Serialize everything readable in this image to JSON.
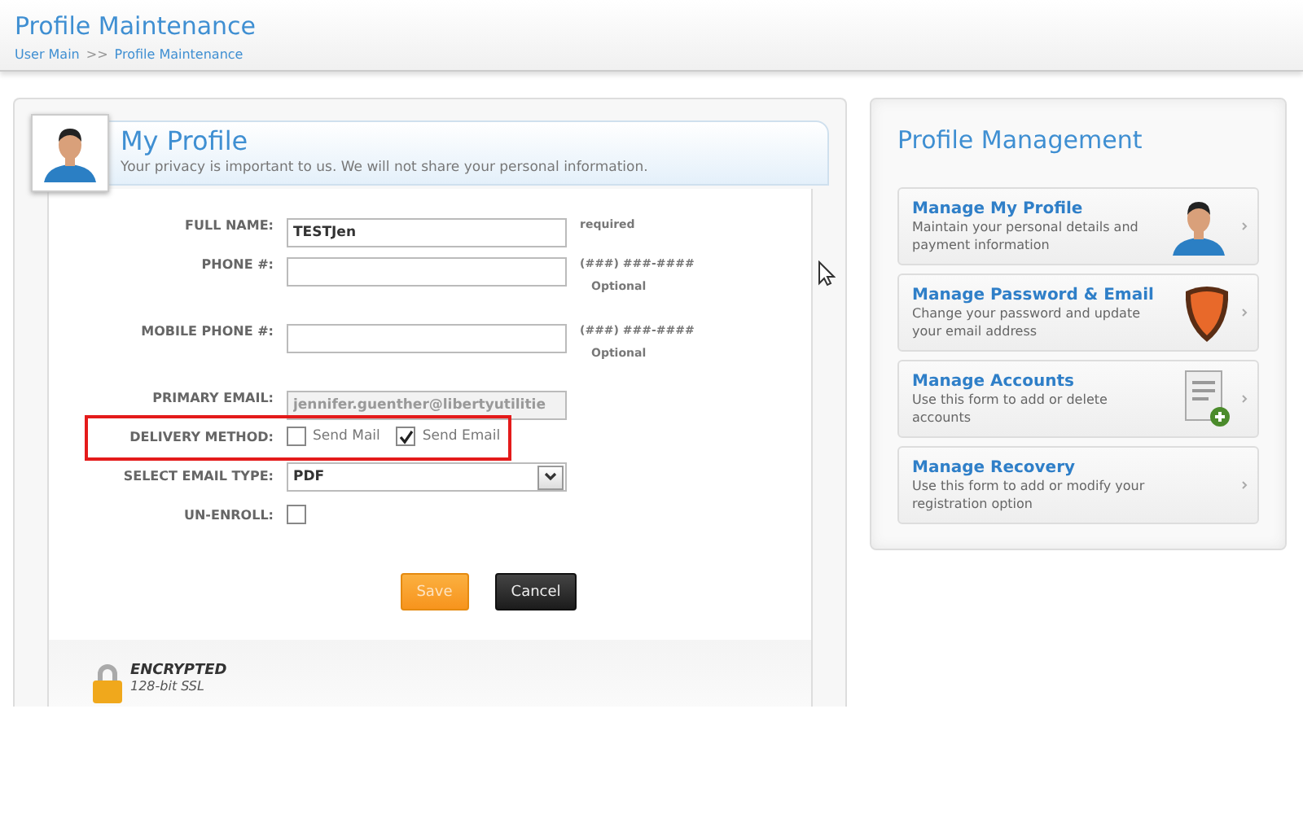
{
  "header": {
    "title": "Profile Maintenance",
    "breadcrumb": [
      {
        "label": "User Main"
      },
      {
        "label": ">>",
        "kind": "separator"
      },
      {
        "label": "Profile Maintenance"
      }
    ]
  },
  "profile": {
    "title": "My Profile",
    "subtitle": "Your privacy is important to us. We will not share your personal information.",
    "fields": [
      {
        "kind": "text",
        "label": "FULL NAME:",
        "value": "TESTJen",
        "hint": "required"
      },
      {
        "kind": "text",
        "label": "PHONE #:",
        "hint": "(###) ###-####",
        "note": "Optional"
      },
      {
        "kind": "text",
        "label": "MOBILE PHONE #:",
        "hint": "(###) ###-####",
        "note": "Optional"
      },
      {
        "kind": "text",
        "label": "PRIMARY EMAIL:",
        "value": "jennifer.guenther@libertyutilitie",
        "disabled": true
      },
      {
        "kind": "checkboxes",
        "label": "DELIVERY METHOD:",
        "highlighted": true,
        "options": [
          {
            "label": "Send Mail",
            "checked": false
          },
          {
            "label": "Send Email",
            "checked": true
          }
        ]
      },
      {
        "kind": "select",
        "label": "SELECT EMAIL TYPE:",
        "value": "PDF"
      },
      {
        "kind": "checkbox",
        "label": "UN-ENROLL:",
        "checked": false
      }
    ],
    "buttons": [
      {
        "label": "Save",
        "kind": "primary"
      },
      {
        "label": "Cancel",
        "kind": "secondary"
      }
    ],
    "security": {
      "title": "ENCRYPTED",
      "subtitle": "128-bit SSL"
    }
  },
  "management": {
    "title": "Profile Management",
    "items": [
      {
        "title": "Manage My Profile",
        "description": "Maintain your personal details and payment information"
      },
      {
        "title": "Manage Password & Email",
        "description": "Change your password and update your email address"
      },
      {
        "title": "Manage Accounts",
        "description": "Use this form to add or delete accounts"
      },
      {
        "title": "Manage Recovery",
        "description": "Use this form to add or modify your registration option"
      }
    ]
  }
}
